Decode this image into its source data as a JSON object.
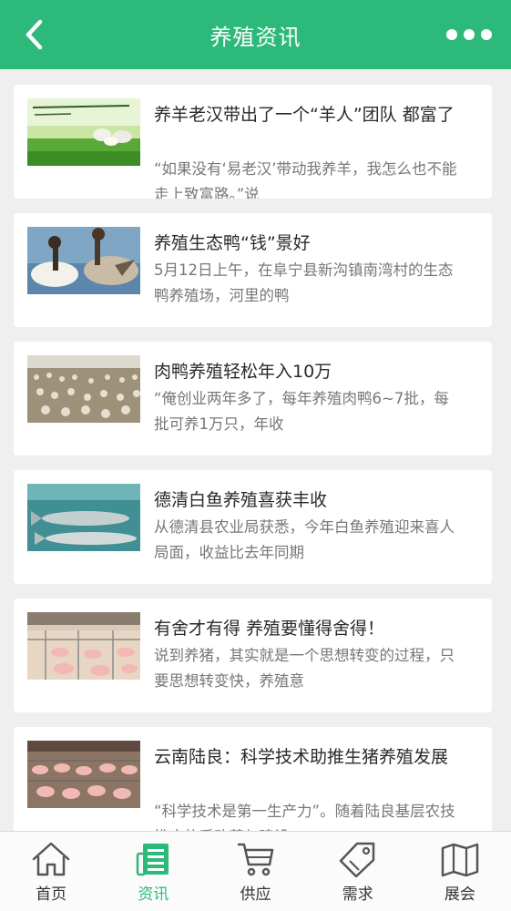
{
  "header": {
    "title": "养殖资讯"
  },
  "articles": [
    {
      "title": "养羊老汉带出了一个“羊人”团队 都富了",
      "desc": "“如果没有‘易老汉’带动我养羊，我怎么也不能走上致富路。”说",
      "image": "sheep-photo"
    },
    {
      "title": "养殖生态鸭“钱”景好",
      "desc": "5月12日上午，在阜宁县新沟镇南湾村的生态鸭养殖场，河里的鸭",
      "image": "ducks-photo"
    },
    {
      "title": "肉鸭养殖轻松年入10万",
      "desc": "“俺创业两年多了，每年养殖肉鸭6~7批，每批可养1万只，年收",
      "image": "duck-farm-photo"
    },
    {
      "title": "德清白鱼养殖喜获丰收",
      "desc": "从德清县农业局获悉，今年白鱼养殖迎来喜人局面，收益比去年同期",
      "image": "fish-photo"
    },
    {
      "title": "有舍才有得 养殖要懂得舍得！",
      "desc": "说到养猪，其实就是一个思想转变的过程，只要思想转变快，养殖意",
      "image": "pig-pen-photo"
    },
    {
      "title": "云南陆良：科学技术助推生猪养殖发展",
      "desc": "“科学技术是第一生产力”。随着陆良基层农技推广体系改革与建设",
      "image": "pig-farm-photo"
    }
  ],
  "tabs": [
    {
      "label": "首页",
      "icon": "home-icon",
      "active": false
    },
    {
      "label": "资讯",
      "icon": "news-icon",
      "active": true
    },
    {
      "label": "供应",
      "icon": "cart-icon",
      "active": false
    },
    {
      "label": "需求",
      "icon": "tag-icon",
      "active": false
    },
    {
      "label": "展会",
      "icon": "map-icon",
      "active": false
    }
  ],
  "colors": {
    "brand": "#2db97a",
    "background": "#efefef"
  }
}
